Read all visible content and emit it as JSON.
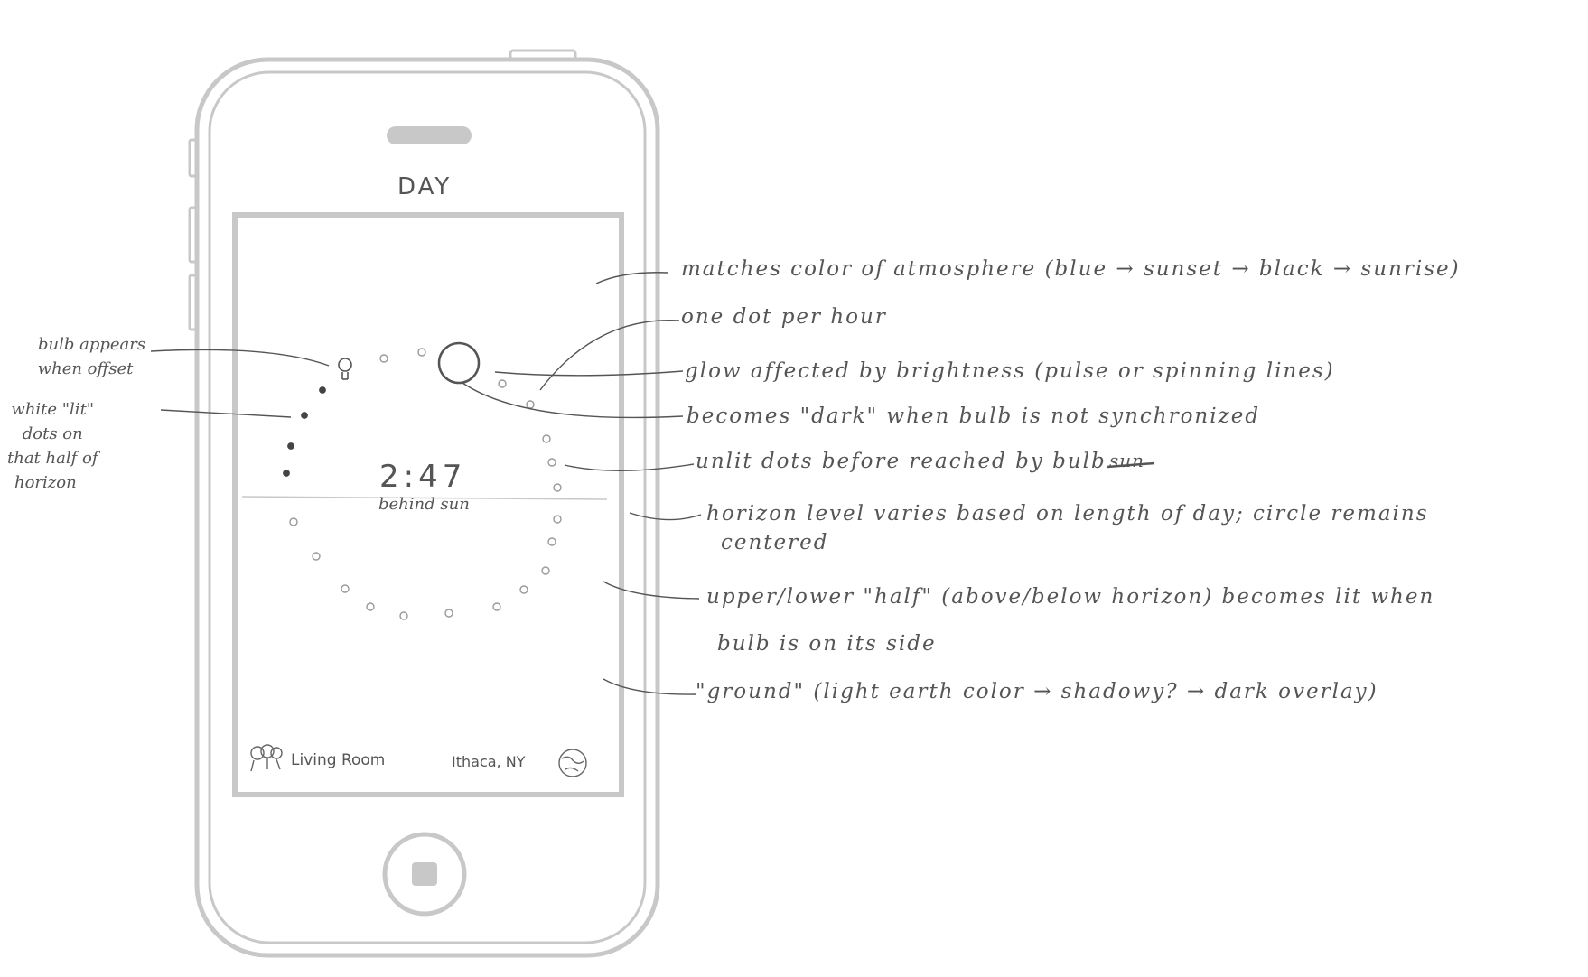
{
  "phone": {
    "header": "DAY",
    "time": "2:47",
    "time_sub": "behind sun",
    "room_label": "Living Room",
    "location_label": "Ithaca, NY",
    "icons": [
      "bulbs-icon",
      "globe-icon",
      "sun-icon",
      "bulb-icon",
      "home-button-icon"
    ]
  },
  "annotations_right": [
    "matches color of atmosphere (blue → sunset → black → sunrise)",
    "one dot per hour",
    "glow affected by brightness (pulse or spinning lines)",
    "becomes \"dark\" when bulb is not synchronized",
    "unlit dots before reached by bulb",
    "horizon level varies based on length of day; circle remains",
    "centered",
    "upper/lower \"half\" (above/below horizon) becomes lit when",
    "bulb is on its side",
    "\"ground\" (light earth color → shadowy? → dark overlay)"
  ],
  "struck_word": "sun",
  "annotations_left": {
    "bulb_offset": [
      "bulb appears",
      "when offset"
    ],
    "lit_dots": [
      "white \"lit\"",
      "dots on",
      "that half of",
      "horizon"
    ]
  },
  "colors": {
    "phone_outline": "#c8c8c8",
    "pencil": "#555555",
    "background": "#ffffff"
  }
}
